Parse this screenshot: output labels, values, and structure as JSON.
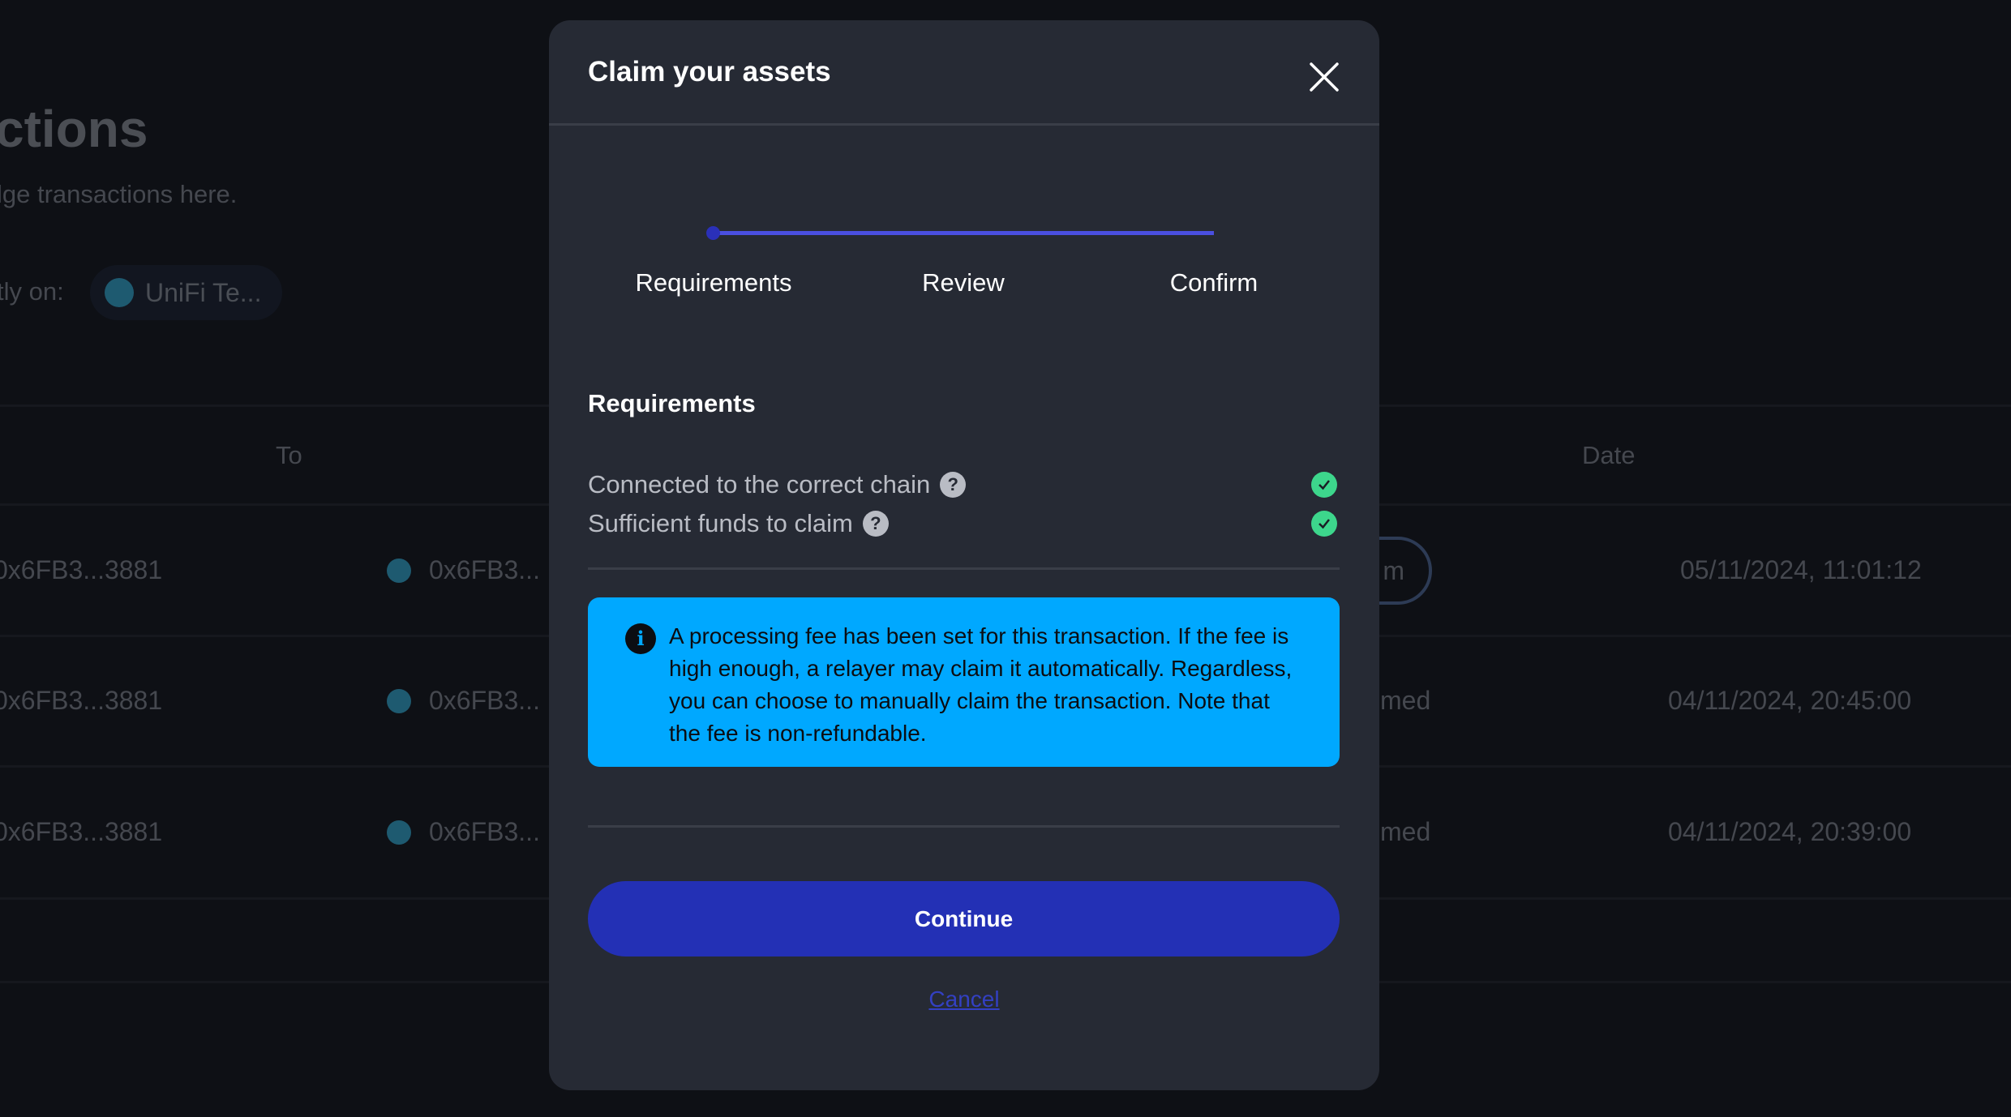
{
  "background": {
    "title": "ctions",
    "subtitle": "lge transactions here.",
    "network_label": "tly on:",
    "network_chip": "UniFi Te...",
    "columns": {
      "to": "To",
      "date": "Date"
    },
    "rows": [
      {
        "from": "0x6FB3...3881",
        "to": "0x6FB3...",
        "status": "m",
        "status_type": "button",
        "date": "05/11/2024, 11:01:12"
      },
      {
        "from": "0x6FB3...3881",
        "to": "0x6FB3...",
        "status": "med",
        "status_type": "text",
        "date": "04/11/2024, 20:45:00"
      },
      {
        "from": "0x6FB3...3881",
        "to": "0x6FB3...",
        "status": "med",
        "status_type": "text",
        "date": "04/11/2024, 20:39:00"
      }
    ]
  },
  "modal": {
    "title": "Claim your assets",
    "close_icon": "close-icon",
    "steps": [
      "Requirements",
      "Review",
      "Confirm"
    ],
    "current_step": 1,
    "section_title": "Requirements",
    "requirements": [
      {
        "label": "Connected to the correct chain",
        "met": true
      },
      {
        "label": "Sufficient funds to claim",
        "met": true
      }
    ],
    "info_text": "A processing fee has been set for this transaction. If the fee is high enough, a relayer may claim it automatically. Regardless, you can choose to manually claim the transaction. Note that the fee is non-refundable.",
    "continue_label": "Continue",
    "cancel_label": "Cancel"
  },
  "colors": {
    "accent": "#2330b5",
    "info": "#00a8ff",
    "success": "#3dd68c",
    "progress": "#4a4fe0"
  }
}
